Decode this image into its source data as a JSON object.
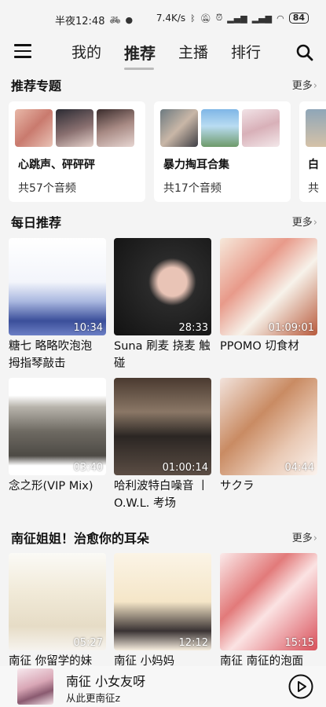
{
  "status_bar": {
    "time": "半夜12:48",
    "network_speed": "7.4K/s",
    "battery": "84",
    "icons": [
      "bike-icon",
      "qq-penguin-icon",
      "bluetooth-icon",
      "mute-icon",
      "alarm-icon",
      "signal-hd-icon",
      "signal-hd-icon",
      "wifi-icon",
      "battery-icon"
    ]
  },
  "nav": {
    "tabs": [
      {
        "label": "我的",
        "active": false
      },
      {
        "label": "推荐",
        "active": true
      },
      {
        "label": "主播",
        "active": false
      },
      {
        "label": "排行",
        "active": false
      }
    ],
    "menu_icon": "hamburger-menu-icon",
    "search_icon": "search-icon"
  },
  "topics": {
    "title": "推荐专题",
    "more": "更多",
    "cards": [
      {
        "title": "心跳声、砰砰砰",
        "count": "共57个音频"
      },
      {
        "title": "暴力掏耳合集",
        "count": "共17个音频"
      },
      {
        "title": "白",
        "count": "共"
      }
    ]
  },
  "daily": {
    "title": "每日推荐",
    "more": "更多",
    "items": [
      {
        "title": "糖七 略略吹泡泡 拇指琴敲击",
        "duration": "10:34"
      },
      {
        "title": "Suna 刷麦 挠麦 触碰",
        "duration": "28:33"
      },
      {
        "title": "PPOMO 切食材",
        "duration": "01:09:01"
      },
      {
        "title": "念之形(VIP Mix)",
        "duration": "03:40"
      },
      {
        "title": "哈利波特白噪音 丨O.W.L. 考场",
        "duration": "01:00:14"
      },
      {
        "title": "サクラ",
        "duration": "04:44"
      }
    ]
  },
  "nanzheng": {
    "title": "南征姐姐！治愈你的耳朵",
    "more": "更多",
    "items": [
      {
        "title": "南征 你留学的妹",
        "duration": "05:27"
      },
      {
        "title": "南征 小妈妈",
        "duration": "12:12"
      },
      {
        "title": "南征 南征的泡面",
        "duration": "15:15"
      }
    ]
  },
  "player": {
    "title": "南征 小女友呀",
    "subtitle": "从此更南征z"
  },
  "colors": {
    "background": "#f4f4f4",
    "card": "#ffffff",
    "text": "#111111"
  }
}
